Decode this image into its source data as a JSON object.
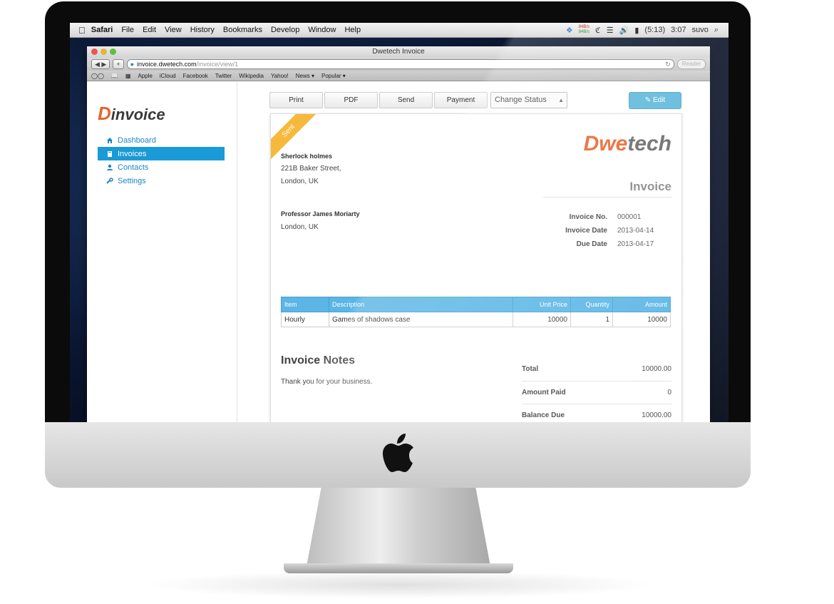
{
  "menubar": {
    "app": "Safari",
    "items": [
      "File",
      "Edit",
      "View",
      "History",
      "Bookmarks",
      "Develop",
      "Window",
      "Help"
    ],
    "net_up": "84B/s",
    "net_down": "84B/s",
    "battery": "(5:13)",
    "clock": "3:07",
    "user": "suvo"
  },
  "browser": {
    "window_title": "Dwetech Invoice",
    "url_host": "invoice.dwetech.com",
    "url_path": "/invoice/view/1",
    "reader_label": "Reader",
    "bookmarks": [
      "Apple",
      "iCloud",
      "Facebook",
      "Twitter",
      "Wikipedia",
      "Yahoo!",
      "News ▾",
      "Popular ▾"
    ]
  },
  "app": {
    "logo_letter": "D",
    "logo_text": "invoice",
    "nav": [
      {
        "label": "Dashboard",
        "icon": "home-icon",
        "active": false
      },
      {
        "label": "Invoices",
        "icon": "book-icon",
        "active": true
      },
      {
        "label": "Contacts",
        "icon": "user-icon",
        "active": false
      },
      {
        "label": "Settings",
        "icon": "wrench-icon",
        "active": false
      }
    ]
  },
  "actions": {
    "print": "Print",
    "pdf": "PDF",
    "send": "Send",
    "payment": "Payment",
    "change_status": "Change Status",
    "edit": "Edit"
  },
  "invoice": {
    "status": "Sent",
    "brand_prefix": "Dwe",
    "brand_suffix": "tech",
    "title": "Invoice",
    "from": {
      "name": "Sherlock holmes",
      "address1": "221B Baker Street,",
      "address2": "London, UK"
    },
    "to": {
      "name": "Professor James Moriarty",
      "address1": "London, UK"
    },
    "meta": {
      "number_label": "Invoice No.",
      "number": "000001",
      "date_label": "Invoice Date",
      "date": "2013-04-14",
      "due_label": "Due Date",
      "due": "2013-04-17"
    },
    "columns": [
      "Item",
      "Description",
      "Unit Price",
      "Quantity",
      "Amount"
    ],
    "rows": [
      [
        "Hourly",
        "Games of shadows case",
        "10000",
        "1",
        "10000"
      ]
    ],
    "notes_heading": "Invoice Notes",
    "notes_text": "Thank you for your business.",
    "totals": {
      "total_label": "Total",
      "total": "10000.00",
      "paid_label": "Amount Paid",
      "paid": "0",
      "balance_label": "Balance Due",
      "balance": "10000.00"
    }
  },
  "colors": {
    "accent": "#1a9ad6",
    "brand_orange": "#e8632b",
    "table_header": "#5bb6e6",
    "ribbon": "#f6b93b"
  }
}
